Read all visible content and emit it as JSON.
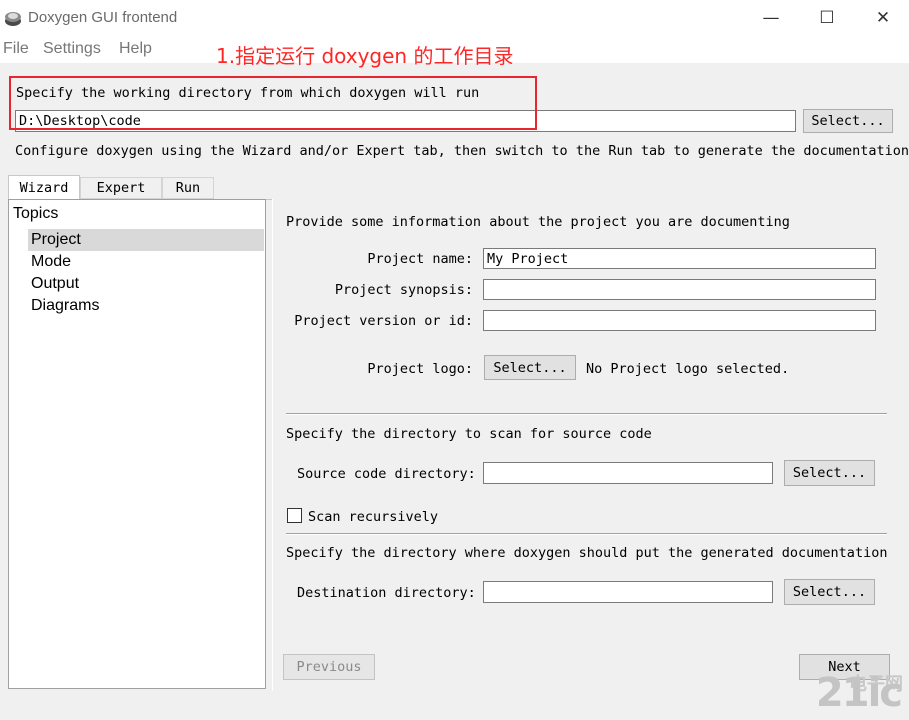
{
  "window": {
    "title": "Doxygen GUI frontend",
    "minimize_glyph": "—",
    "maximize_glyph": "☐",
    "close_glyph": "✕"
  },
  "menu": [
    "File",
    "Settings",
    "Help"
  ],
  "annotation": "1.指定运行 doxygen 的工作目录",
  "workdir": {
    "label": "Specify the working directory from which doxygen will run",
    "value": "D:\\Desktop\\code",
    "select_label": "Select..."
  },
  "instructions": "Configure doxygen using the Wizard and/or Expert tab, then switch to the Run tab to generate the documentation",
  "tabs": [
    {
      "label": "Wizard",
      "active": true
    },
    {
      "label": "Expert",
      "active": false
    },
    {
      "label": "Run",
      "active": false
    }
  ],
  "topics": {
    "heading": "Topics",
    "items": [
      "Project",
      "Mode",
      "Output",
      "Diagrams"
    ],
    "selected": "Project"
  },
  "project": {
    "intro": "Provide some information about the project you are documenting",
    "name_label": "Project name:",
    "name_value": "My Project",
    "synopsis_label": "Project synopsis:",
    "synopsis_value": "",
    "version_label": "Project version or id:",
    "version_value": "",
    "logo_label": "Project logo:",
    "logo_button": "Select...",
    "logo_status": "No Project logo selected."
  },
  "source": {
    "intro": "Specify the directory to scan for source code",
    "dir_label": "Source code directory:",
    "dir_value": "",
    "select_label": "Select...",
    "recursive_label": "Scan recursively",
    "recursive_checked": false
  },
  "destination": {
    "intro": "Specify the directory where doxygen should put the generated documentation",
    "dir_label": "Destination directory:",
    "dir_value": "",
    "select_label": "Select..."
  },
  "nav": {
    "previous_label": "Previous",
    "next_label": "Next"
  },
  "watermark": {
    "main": "21ic",
    "sub": "电子网"
  },
  "colors": {
    "annotation": "#ff2626",
    "highlight_box": "#e8262f"
  }
}
